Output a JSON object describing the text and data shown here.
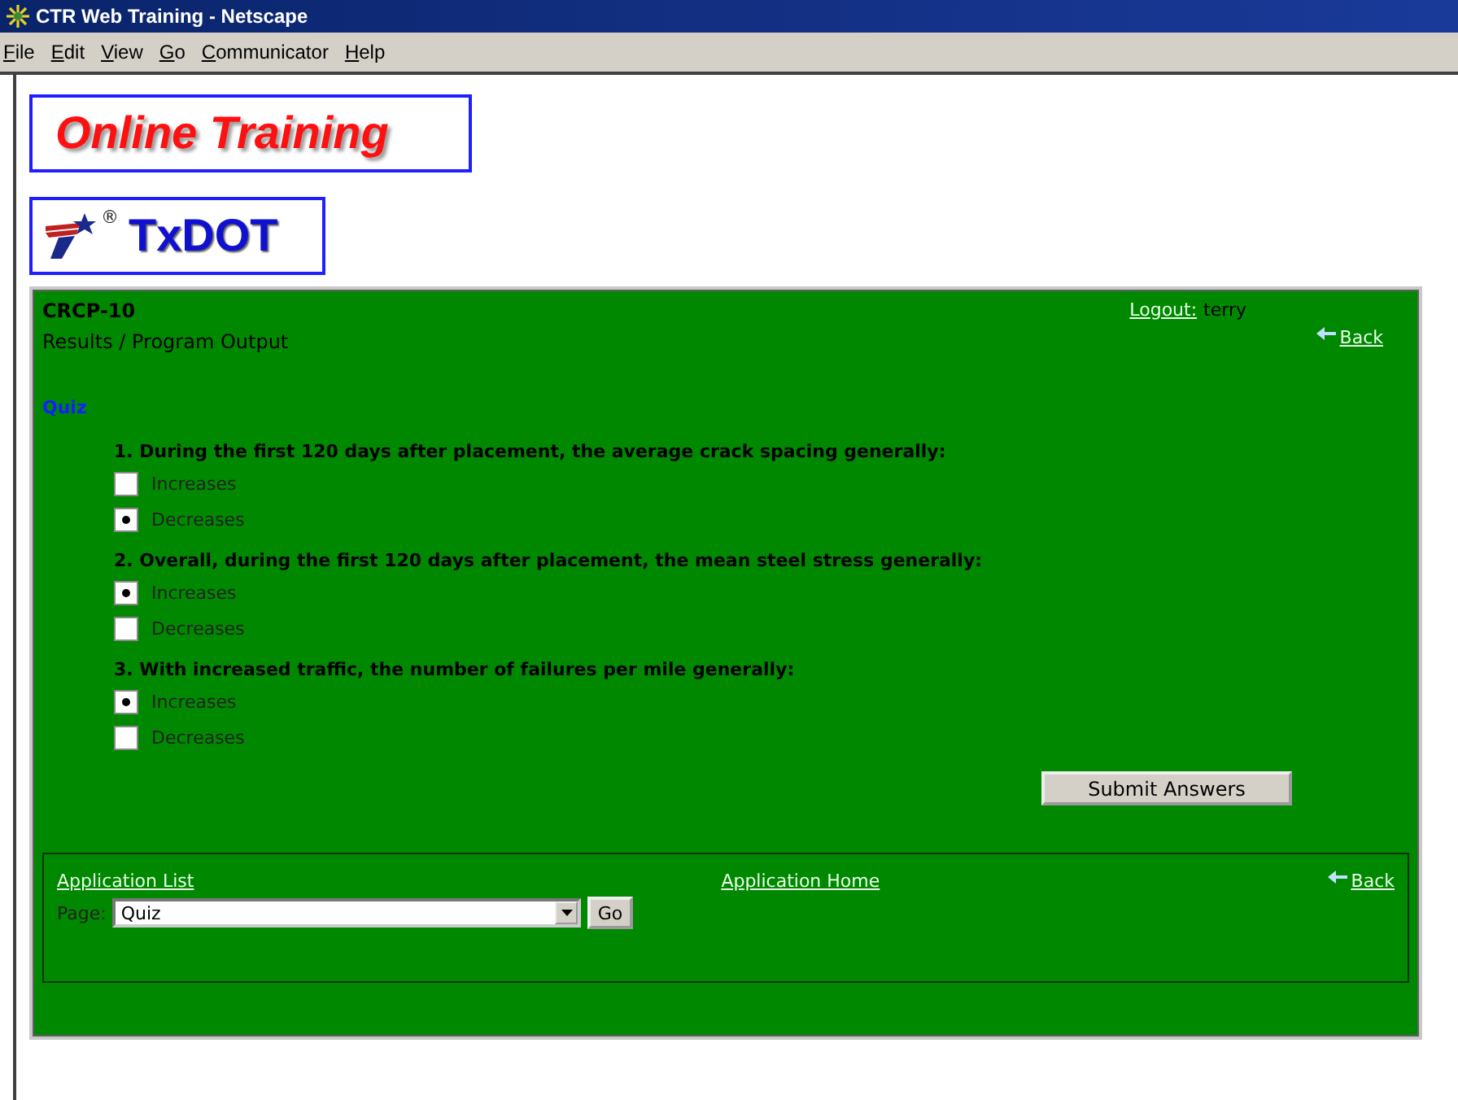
{
  "window": {
    "title": "CTR Web Training - Netscape"
  },
  "menu": [
    "File",
    "Edit",
    "View",
    "Go",
    "Communicator",
    "Help"
  ],
  "banner": {
    "title": "Online Training"
  },
  "logo": {
    "text": "TxDOT",
    "mark": "®"
  },
  "header": {
    "course": "CRCP-10",
    "section": "Results / Program Output",
    "logout_link": "Logout:",
    "user": "terry",
    "back": "Back"
  },
  "heading": "Quiz",
  "questions": [
    {
      "text": "1. During the first 120 days after placement, the average crack spacing generally:",
      "options": [
        {
          "label": "Increases",
          "selected": false
        },
        {
          "label": "Decreases",
          "selected": true
        }
      ]
    },
    {
      "text": "2. Overall, during the first 120 days after placement, the mean steel stress generally:",
      "options": [
        {
          "label": "Increases",
          "selected": true
        },
        {
          "label": "Decreases",
          "selected": false
        }
      ]
    },
    {
      "text": "3. With increased traffic, the number of failures per mile generally:",
      "options": [
        {
          "label": "Increases",
          "selected": true
        },
        {
          "label": "Decreases",
          "selected": false
        }
      ]
    }
  ],
  "submit": "Submit Answers",
  "footer": {
    "app_list": "Application List",
    "app_home": "Application Home",
    "back": "Back",
    "page_label": "Page:",
    "page_value": "Quiz",
    "go": "Go"
  }
}
